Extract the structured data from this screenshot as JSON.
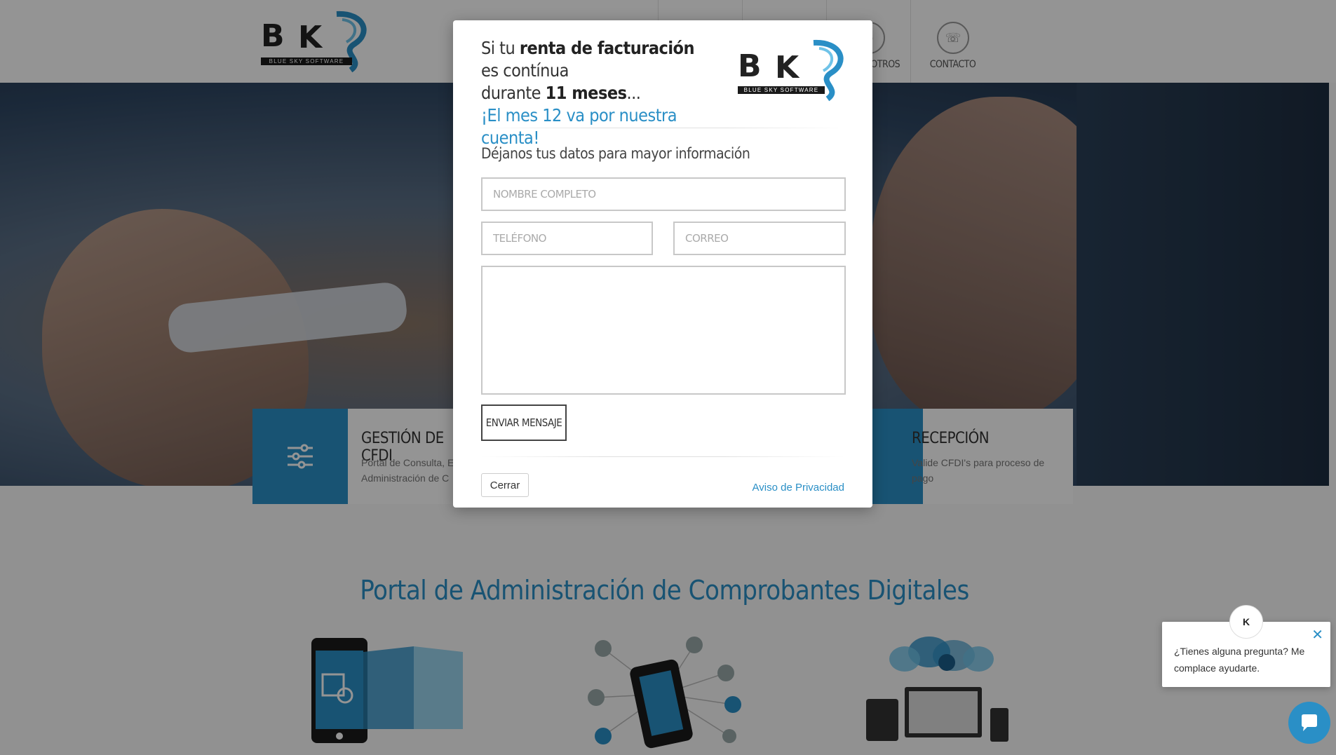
{
  "header": {
    "logo_letters": "BKS",
    "logo_tagline": "BLUE SKY SOFTWARE",
    "nav": [
      {
        "label": "",
        "icon": "nav-icon"
      },
      {
        "label": "",
        "icon": "nav-icon"
      },
      {
        "label": "SOTROS",
        "icon": "users-icon"
      },
      {
        "label": "CONTACTO",
        "icon": "phone-icon"
      }
    ]
  },
  "features": [
    {
      "title": "GESTIÓN DE CFDI",
      "desc_line1": "Portal de Consulta, E",
      "desc_line2": "Administración de C",
      "icon": "sliders-icon"
    },
    {
      "title": "RECEPCIÓN",
      "desc_line1": "Valide CFDI's para proceso de",
      "desc_line2": "pago",
      "icon": "inbox-icon"
    }
  ],
  "section_title": "Portal de Administración de Comprobantes Digitales",
  "modal": {
    "h_pre1": "Si tu ",
    "h_bold1": "renta de facturación",
    "h_post1": " es contínua",
    "h_pre2": "durante ",
    "h_bold2": "11 meses",
    "h_post2": "...",
    "h_blue": "¡El mes 12 va por nuestra cuenta!",
    "logo_letters": "BKS",
    "logo_tagline": "BLUE SKY SOFTWARE",
    "intro": "Déjanos tus datos para mayor información",
    "name_placeholder": "NOMBRE COMPLETO",
    "phone_placeholder": "TELÉFONO",
    "email_placeholder": "CORREO",
    "send_label": "ENVIAR MENSAJE",
    "close_label": "Cerrar",
    "privacy_label": "Aviso de Privacidad"
  },
  "chat": {
    "message": "¿Tienes alguna pregunta? Me complace ayudarte.",
    "avatar_text": "K"
  },
  "colors": {
    "accent": "#2a8fc6",
    "overlay": "rgba(0,0,0,0.42)"
  }
}
